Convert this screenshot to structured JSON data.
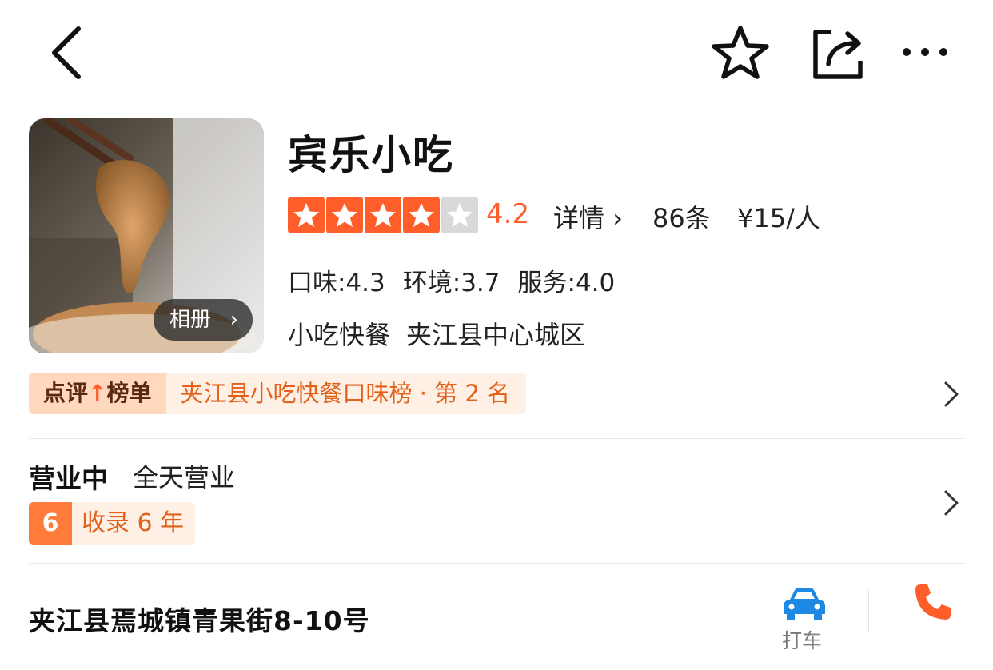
{
  "nav": {
    "back_icon": "chevron-left-icon",
    "favorite_icon": "star-outline-icon",
    "share_icon": "share-icon",
    "more_icon": "more-icon"
  },
  "shop": {
    "name": "宾乐小吃",
    "album_label": "相册",
    "rating": {
      "score": "4.2",
      "stars_filled": 4,
      "stars_total": 5,
      "detail_label": "详情",
      "review_count": "86条",
      "price": "¥15/人"
    },
    "subscores": [
      {
        "text": "口味:4.3"
      },
      {
        "text": "环境:3.7"
      },
      {
        "text": "服务:4.0"
      }
    ],
    "categories": [
      {
        "text": "小吃快餐"
      },
      {
        "text": "夹江县中心城区"
      }
    ]
  },
  "ranking": {
    "badge_prefix": "点评",
    "badge_suffix": "榜单",
    "text": "夹江县小吃快餐口味榜 · 第 2 名"
  },
  "hours": {
    "status": "营业中",
    "hours": "全天营业",
    "years_number": "6",
    "years_text": "收录 6 年"
  },
  "address": {
    "text": "夹江县焉城镇青果街8-10号",
    "taxi_label": "打车",
    "taxi_icon": "car-icon",
    "phone_icon": "phone-icon"
  },
  "colors": {
    "accent": "#ff5e2a",
    "star_off": "#d9d9d9",
    "badge_bg": "#fff0e6",
    "taxi_blue": "#1e88e5"
  }
}
